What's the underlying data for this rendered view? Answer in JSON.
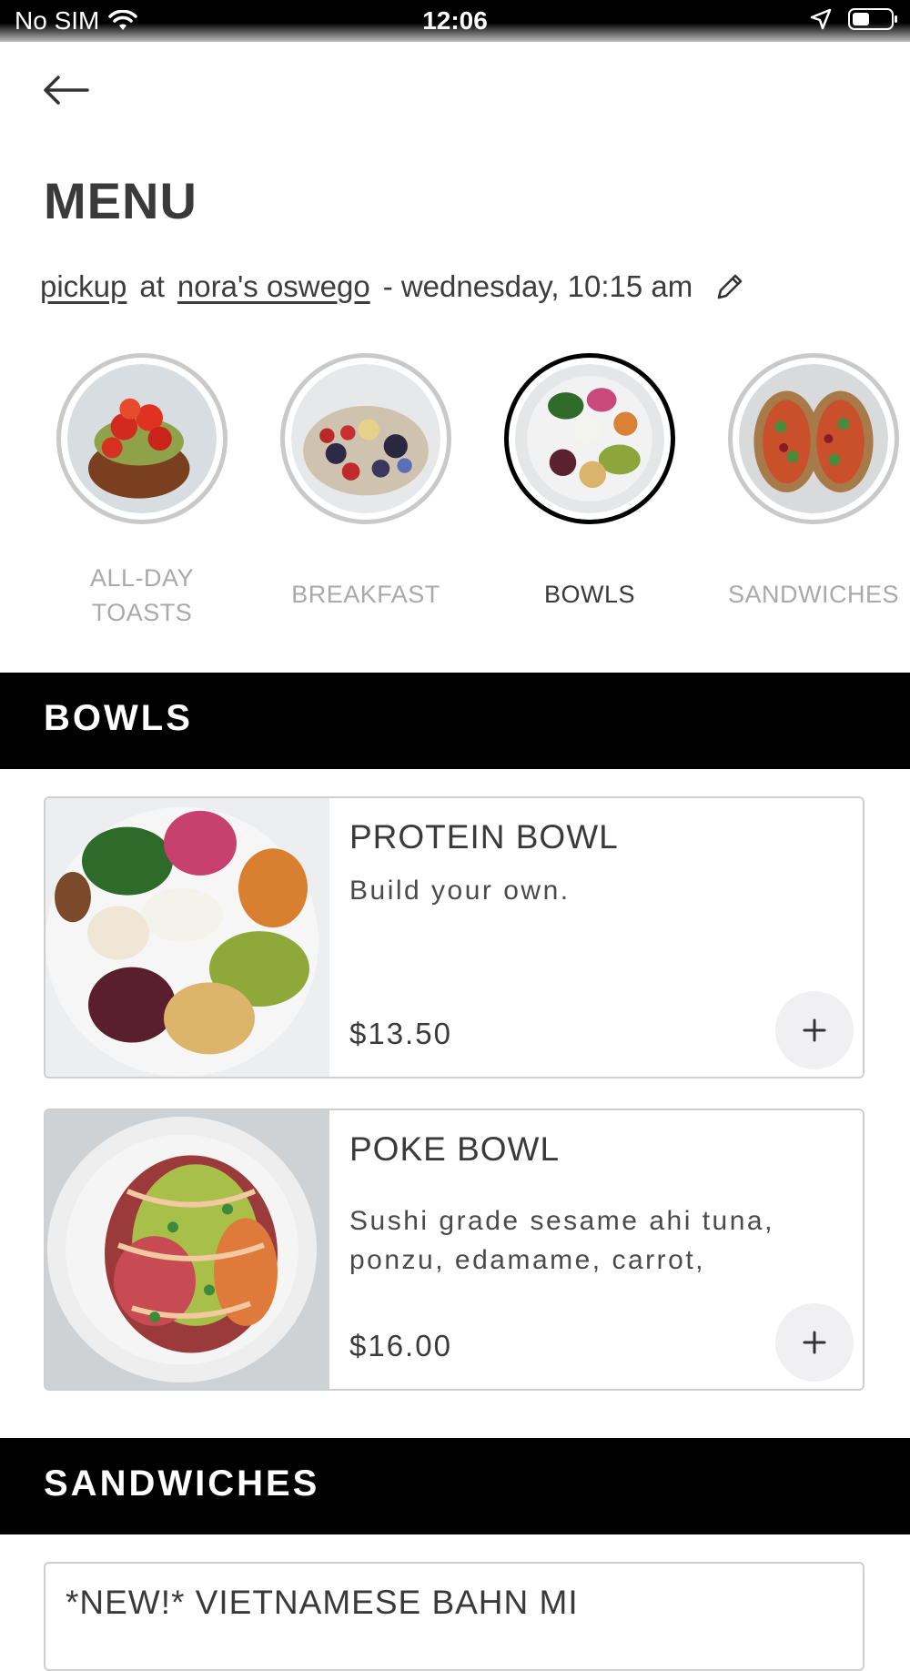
{
  "status_bar": {
    "carrier": "No SIM",
    "time": "12:06"
  },
  "header": {
    "title": "MENU"
  },
  "order": {
    "mode": "pickup",
    "at": "at",
    "location": "nora's oswego",
    "when": "- wednesday, 10:15 am"
  },
  "categories": [
    {
      "label": "ALL-DAY\nTOASTS",
      "active": false
    },
    {
      "label": "BREAKFAST",
      "active": false
    },
    {
      "label": "BOWLS",
      "active": true
    },
    {
      "label": "SANDWICHES",
      "active": false
    }
  ],
  "sections": [
    {
      "title": "BOWLS",
      "items": [
        {
          "name": "PROTEIN BOWL",
          "description": "Build your own.",
          "price": "$13.50"
        },
        {
          "name": "POKE BOWL",
          "description": "Sushi grade sesame ahi tuna, ponzu, edamame, carrot,",
          "price": "$16.00"
        }
      ]
    },
    {
      "title": "SANDWICHES",
      "items": [
        {
          "name": "*NEW!* VIETNAMESE BAHN MI"
        }
      ]
    }
  ],
  "colors": {
    "accent": "#000000",
    "active_ring": "#000000",
    "inactive_ring": "#c9c9c9",
    "muted_text": "#a9a9a9"
  },
  "icons": {
    "back": "arrow-left-icon",
    "edit": "pencil-icon",
    "add": "plus-icon"
  }
}
